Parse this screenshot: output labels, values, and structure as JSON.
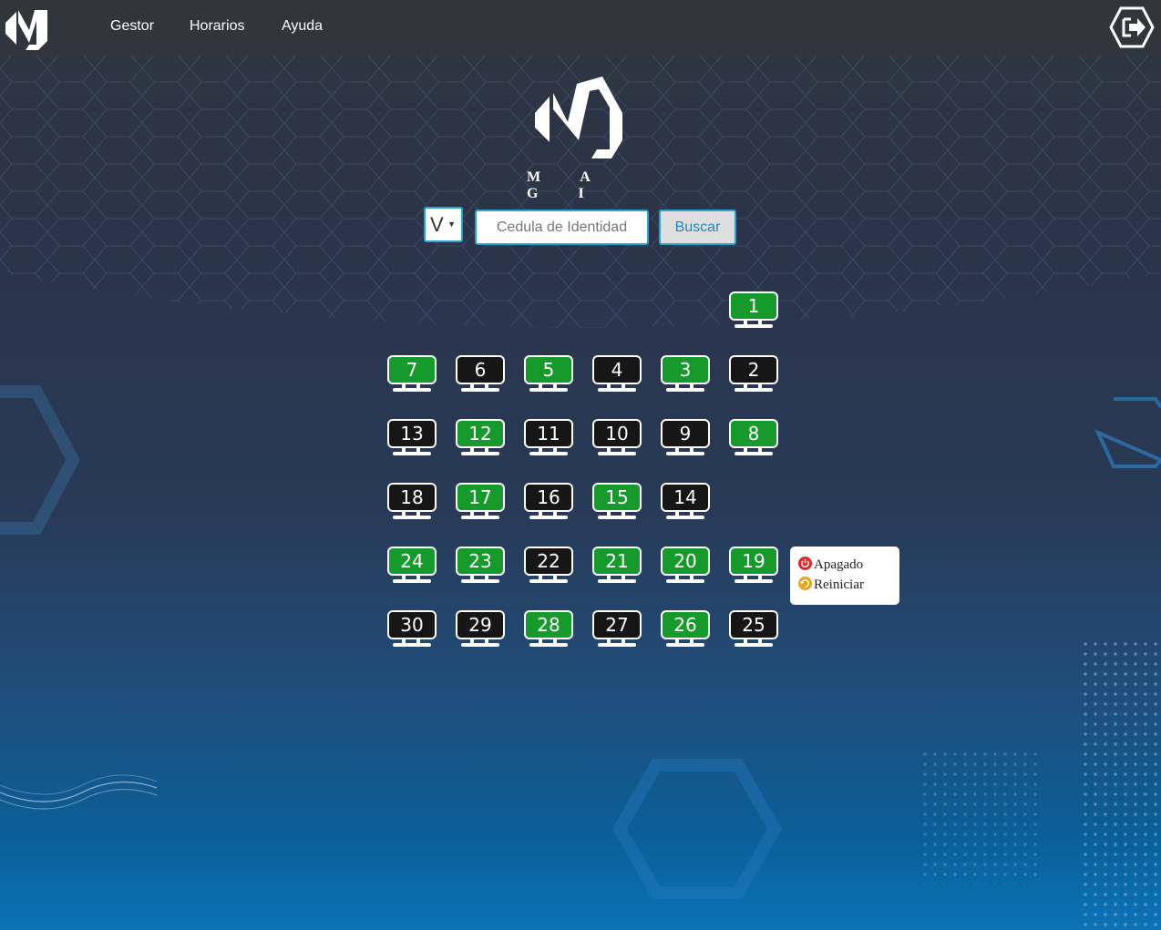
{
  "nav": {
    "links": [
      "Gestor",
      "Horarios",
      "Ayuda"
    ]
  },
  "logo": {
    "text": "M A G I"
  },
  "search": {
    "doc_type": "V",
    "placeholder": "Cedula de Identidad",
    "button_label": "Buscar"
  },
  "computers": [
    {
      "label": "1",
      "status": "on"
    },
    {
      "label": "7",
      "status": "on"
    },
    {
      "label": "6",
      "status": "off"
    },
    {
      "label": "5",
      "status": "on"
    },
    {
      "label": "4",
      "status": "off"
    },
    {
      "label": "3",
      "status": "on"
    },
    {
      "label": "2",
      "status": "off"
    },
    {
      "label": "13",
      "status": "off"
    },
    {
      "label": "12",
      "status": "on"
    },
    {
      "label": "11",
      "status": "off"
    },
    {
      "label": "10",
      "status": "off"
    },
    {
      "label": "9",
      "status": "off"
    },
    {
      "label": "8",
      "status": "on"
    },
    {
      "label": "18",
      "status": "off"
    },
    {
      "label": "17",
      "status": "on"
    },
    {
      "label": "16",
      "status": "off"
    },
    {
      "label": "15",
      "status": "on"
    },
    {
      "label": "14",
      "status": "off"
    },
    {
      "label": "24",
      "status": "on"
    },
    {
      "label": "23",
      "status": "on"
    },
    {
      "label": "22",
      "status": "off"
    },
    {
      "label": "21",
      "status": "on"
    },
    {
      "label": "20",
      "status": "on"
    },
    {
      "label": "19",
      "status": "on"
    },
    {
      "label": "30",
      "status": "off"
    },
    {
      "label": "29",
      "status": "off"
    },
    {
      "label": "28",
      "status": "on"
    },
    {
      "label": "27",
      "status": "off"
    },
    {
      "label": "26",
      "status": "on"
    },
    {
      "label": "25",
      "status": "off"
    }
  ],
  "legend": {
    "items": [
      {
        "label": "Apagado",
        "icon": "power-icon",
        "color": "#e0252a"
      },
      {
        "label": "Reiniciar",
        "icon": "restart-icon",
        "color": "#e8a317"
      }
    ]
  },
  "colors": {
    "accent": "#27a4c9",
    "pc_on": "#169a2c",
    "pc_off": "#161616",
    "navbar": "#31353c"
  }
}
